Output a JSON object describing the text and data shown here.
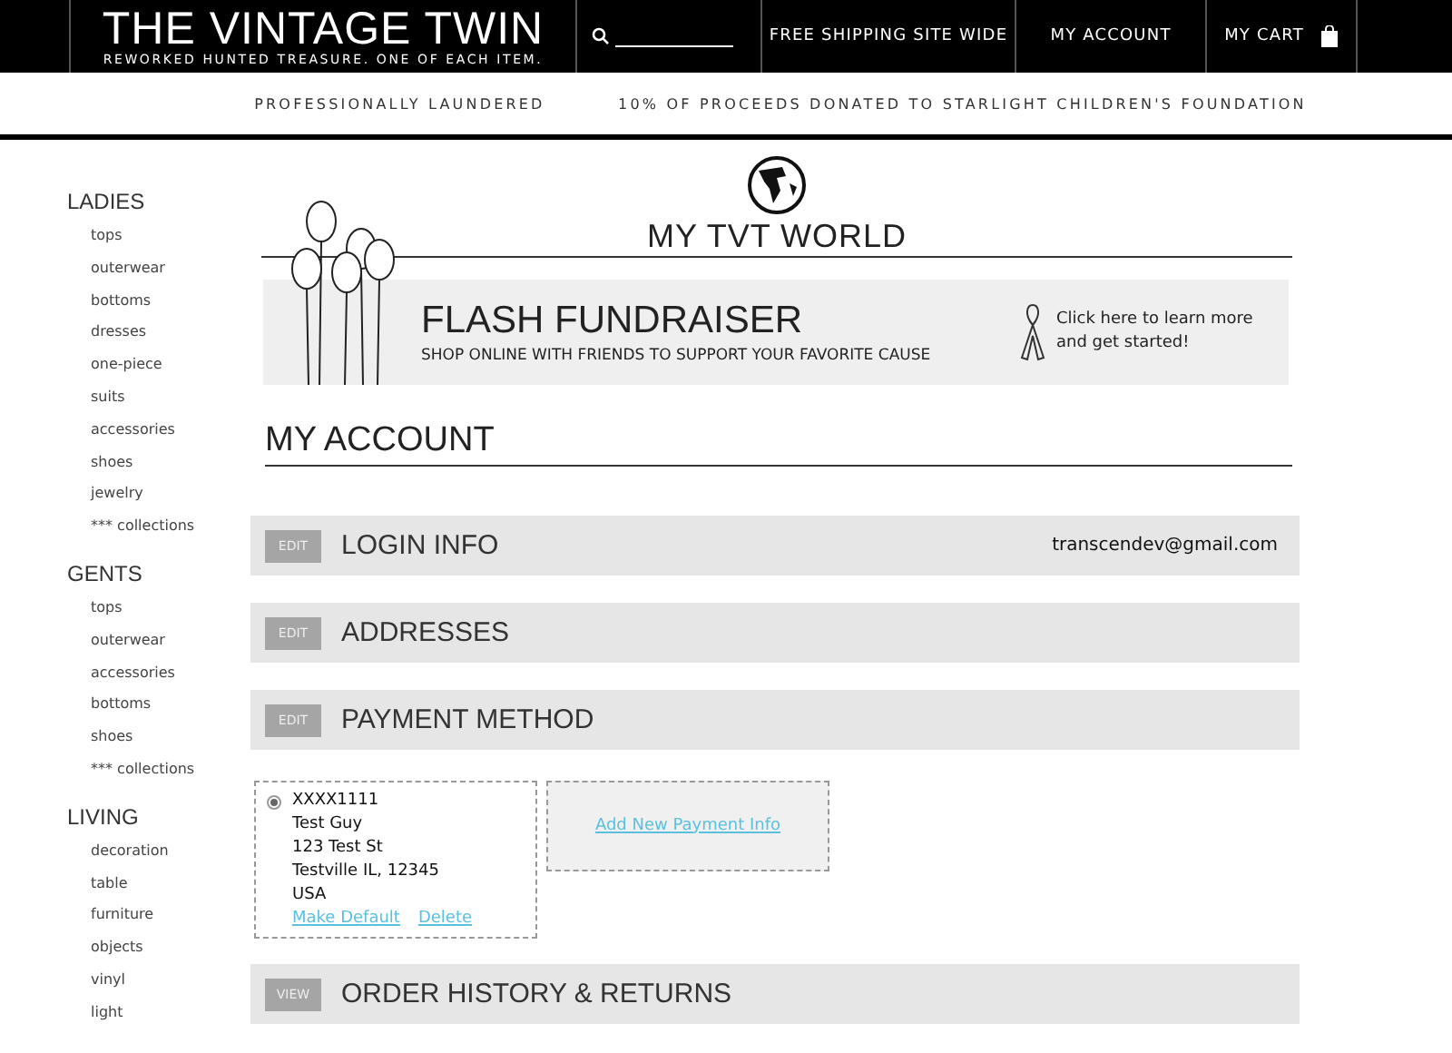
{
  "header": {
    "logo_title": "THE VINTAGE TWIN",
    "logo_tagline": "REWORKED HUNTED TREASURE. ONE OF EACH ITEM.",
    "nav": [
      "FREE SHIPPING SITE WIDE",
      "MY ACCOUNT",
      "MY CART"
    ]
  },
  "promo_bar": [
    "PROFESSIONALLY LAUNDERED",
    "10% OF PROCEEDS DONATED TO STARLIGHT CHILDREN'S FOUNDATION"
  ],
  "sidebar": [
    {
      "title": "LADIES",
      "items": [
        "tops",
        "outerwear",
        "bottoms",
        "dresses",
        "one-piece",
        "suits",
        "accessories",
        "shoes",
        "jewelry",
        "*** collections"
      ]
    },
    {
      "title": "GENTS",
      "items": [
        "tops",
        "outerwear",
        "accessories",
        "bottoms",
        "shoes",
        "*** collections"
      ]
    },
    {
      "title": "LIVING",
      "items": [
        "decoration",
        "table",
        "furniture",
        "objects",
        "vinyl",
        "light"
      ]
    }
  ],
  "page_title": "MY TVT WORLD",
  "fundraiser": {
    "title": "FLASH FUNDRAISER",
    "subtitle": "SHOP ONLINE WITH FRIENDS TO SUPPORT YOUR FAVORITE CAUSE",
    "cta": "Click here to learn more and get started!"
  },
  "account_title": "MY ACCOUNT",
  "sections": [
    {
      "button": "EDIT",
      "title": "LOGIN INFO",
      "value": "transcendev@gmail.com"
    },
    {
      "button": "EDIT",
      "title": "ADDRESSES"
    },
    {
      "button": "EDIT",
      "title": "PAYMENT METHOD",
      "payment_cards": [
        {
          "selected": true,
          "lines": [
            "XXXX1111",
            "Test Guy",
            "123 Test St",
            "Testville IL, 12345",
            "USA"
          ],
          "links": [
            "Make Default",
            "Delete"
          ]
        }
      ],
      "add_link": "Add New Payment Info"
    },
    {
      "button": "VIEW",
      "title": "ORDER HISTORY & RETURNS"
    }
  ]
}
